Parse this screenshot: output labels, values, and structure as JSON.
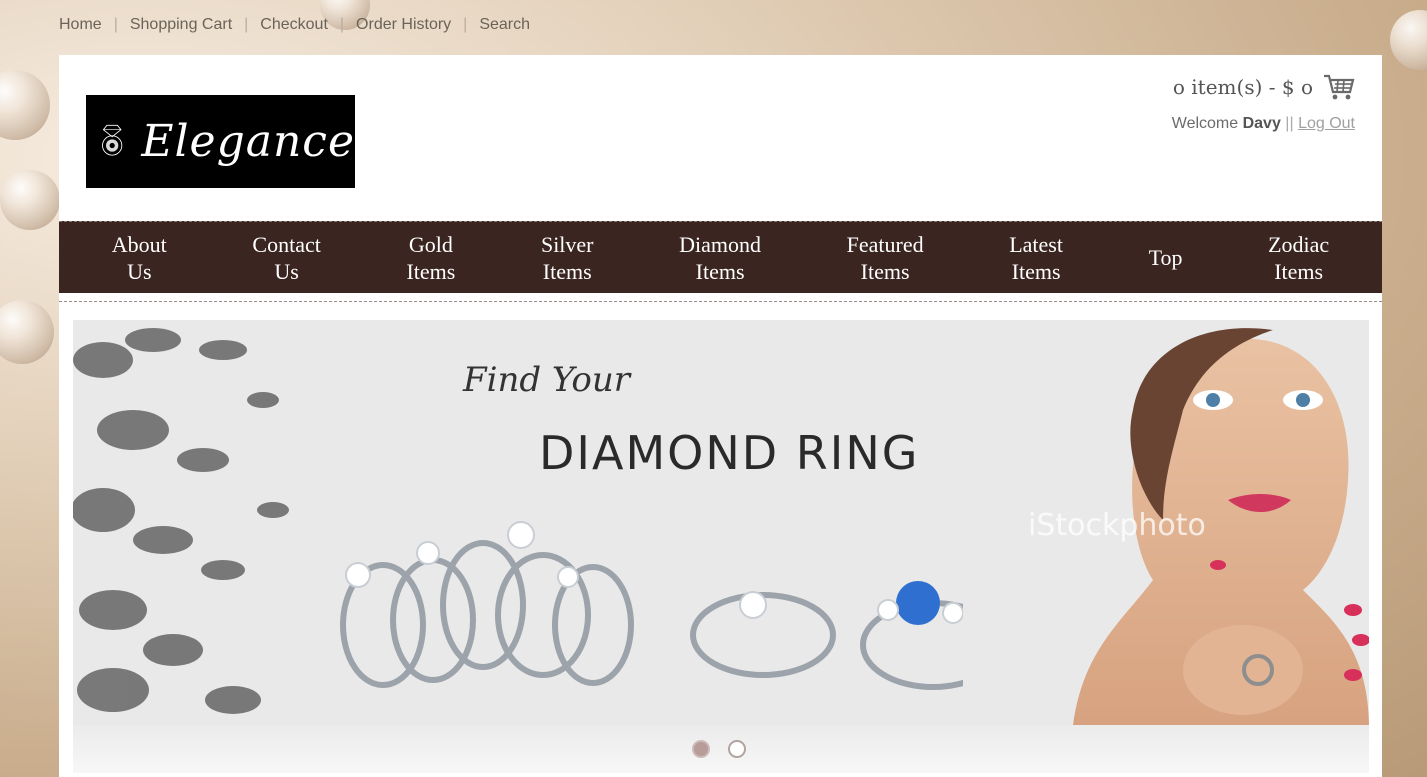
{
  "top_links": [
    "Home",
    "Shopping Cart",
    "Checkout",
    "Order History",
    "Search"
  ],
  "logo": {
    "text": "Elegance"
  },
  "cart": {
    "summary": "o item(s) - $ o"
  },
  "welcome": {
    "prefix": "Welcome",
    "user": "Davy",
    "separator": "||",
    "logout": "Log Out"
  },
  "nav": [
    {
      "line1": "About",
      "line2": "Us"
    },
    {
      "line1": "Contact",
      "line2": "Us"
    },
    {
      "line1": "Gold",
      "line2": "Items"
    },
    {
      "line1": "Silver",
      "line2": "Items"
    },
    {
      "line1": "Diamond",
      "line2": "Items"
    },
    {
      "line1": "Featured",
      "line2": "Items"
    },
    {
      "line1": "Latest",
      "line2": "Items"
    },
    {
      "line1": "Top",
      "line2": ""
    },
    {
      "line1": "Zodiac",
      "line2": "Items"
    }
  ],
  "banner": {
    "script_text": "Find Your",
    "headline": "DIAMOND RING",
    "watermark": "iStockphoto"
  },
  "slider": {
    "active_index": 0,
    "count": 2
  },
  "colors": {
    "nav_bg": "#3b2520",
    "dot_active": "#b89c99"
  }
}
